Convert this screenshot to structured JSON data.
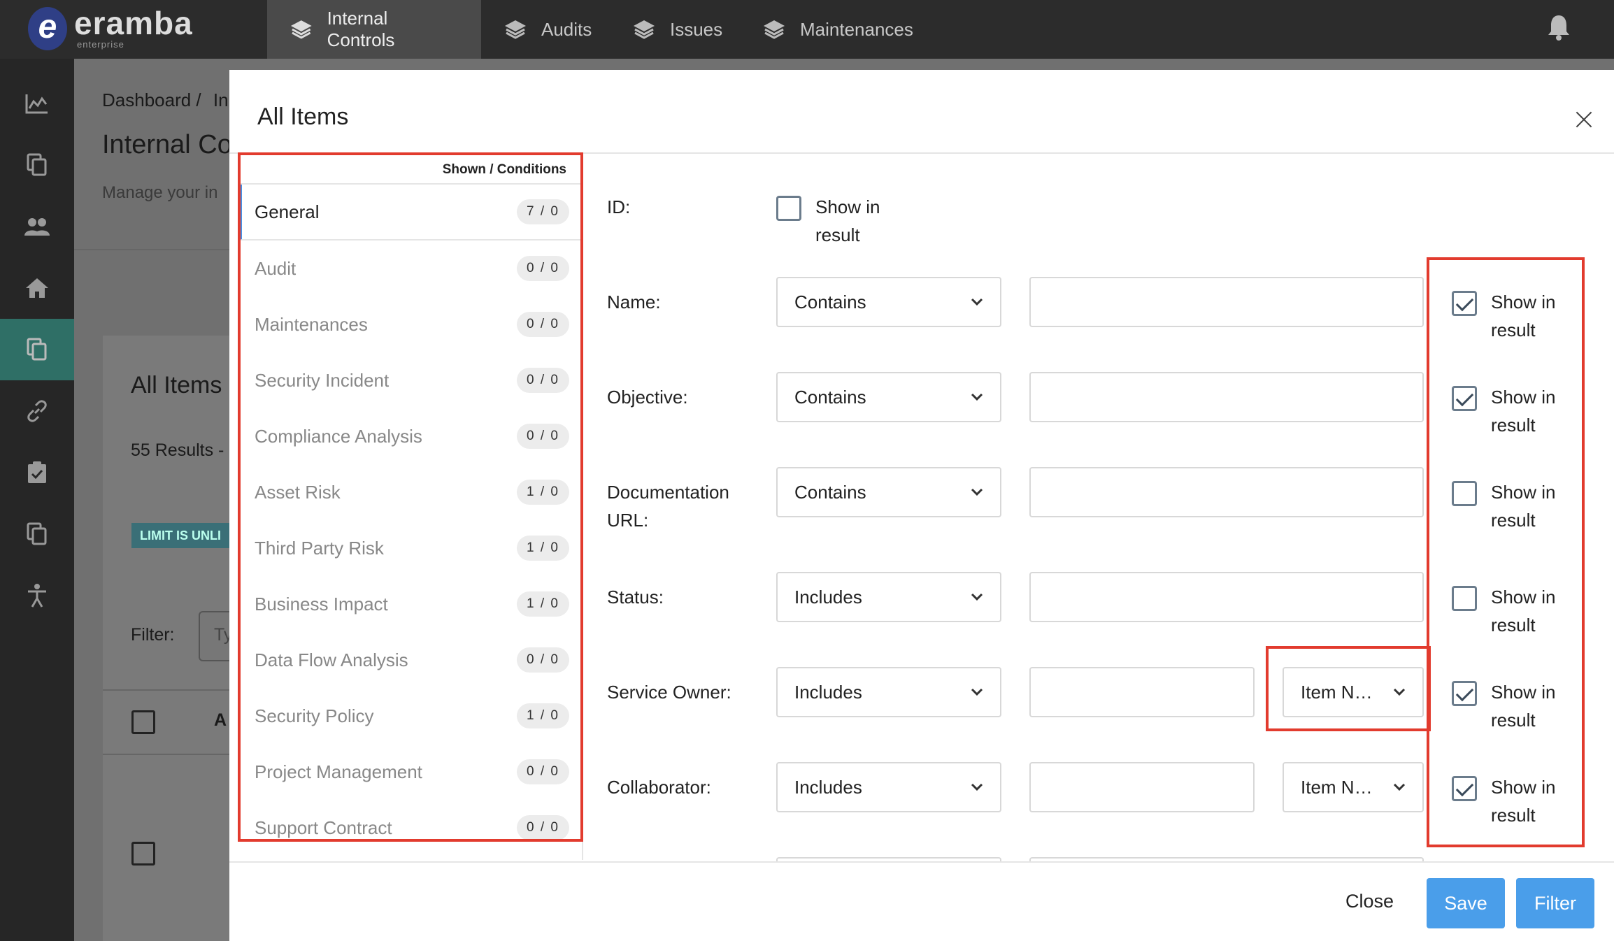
{
  "brand": {
    "name": "eramba",
    "sub": "enterprise",
    "mark": "e"
  },
  "nav": {
    "tabs": [
      {
        "label": "Internal Controls",
        "active": true
      },
      {
        "label": "Audits",
        "active": false
      },
      {
        "label": "Issues",
        "active": false
      },
      {
        "label": "Maintenances",
        "active": false
      }
    ]
  },
  "sidebar": {
    "icons": [
      "chart-icon",
      "copy-icon",
      "users-icon",
      "home-icon",
      "copy-icon",
      "link-icon",
      "clipboard-icon",
      "copy-icon",
      "accessibility-icon"
    ],
    "active_index": 4
  },
  "background": {
    "breadcrumb": "Dashboard /",
    "breadcrumb_next": "In",
    "page_title": "Internal Co",
    "page_desc": "Manage your in",
    "card_title": "All Items",
    "results": "55 Results -",
    "limit_badge": "LIMIT IS UNLI",
    "filter_label": "Filter:",
    "filter_placeholder": "Ty",
    "col_letter": "A"
  },
  "modal": {
    "title": "All Items",
    "categories_header": "Shown / Conditions",
    "categories": [
      {
        "label": "General",
        "count": "7 / 0",
        "active": true
      },
      {
        "label": "Audit",
        "count": "0 / 0"
      },
      {
        "label": "Maintenances",
        "count": "0 / 0"
      },
      {
        "label": "Security Incident",
        "count": "0 / 0"
      },
      {
        "label": "Compliance Analysis",
        "count": "0 / 0"
      },
      {
        "label": "Asset Risk",
        "count": "1 / 0"
      },
      {
        "label": "Third Party Risk",
        "count": "1 / 0"
      },
      {
        "label": "Business Impact",
        "count": "1 / 0"
      },
      {
        "label": "Data Flow Analysis",
        "count": "0 / 0"
      },
      {
        "label": "Security Policy",
        "count": "1 / 0"
      },
      {
        "label": "Project Management",
        "count": "0 / 0"
      },
      {
        "label": "Support Contract",
        "count": "0 / 0"
      }
    ],
    "fields": [
      {
        "label": "ID:",
        "show_label": "Show in result",
        "checked": false
      },
      {
        "label": "Name:",
        "operator": "Contains",
        "value": "",
        "show_label": "Show in result",
        "checked": true
      },
      {
        "label": "Objective:",
        "operator": "Contains",
        "value": "",
        "show_label": "Show in result",
        "checked": true
      },
      {
        "label": "Documentation URL:",
        "operator": "Contains",
        "value": "",
        "show_label": "Show in result",
        "checked": false
      },
      {
        "label": "Status:",
        "operator": "Includes",
        "value": "",
        "show_label": "Show in result",
        "checked": false
      },
      {
        "label": "Service Owner:",
        "operator": "Includes",
        "value": "",
        "subselect": "Item N…",
        "show_label": "Show in result",
        "checked": true
      },
      {
        "label": "Collaborator:",
        "operator": "Includes",
        "value": "",
        "subselect": "Item N…",
        "show_label": "Show in result",
        "checked": true
      }
    ],
    "footer": {
      "close": "Close",
      "save": "Save",
      "filter": "Filter"
    }
  },
  "colors": {
    "accent": "#4a9eea",
    "highlight": "#e23b2e",
    "active_side": "#2f6f66"
  }
}
